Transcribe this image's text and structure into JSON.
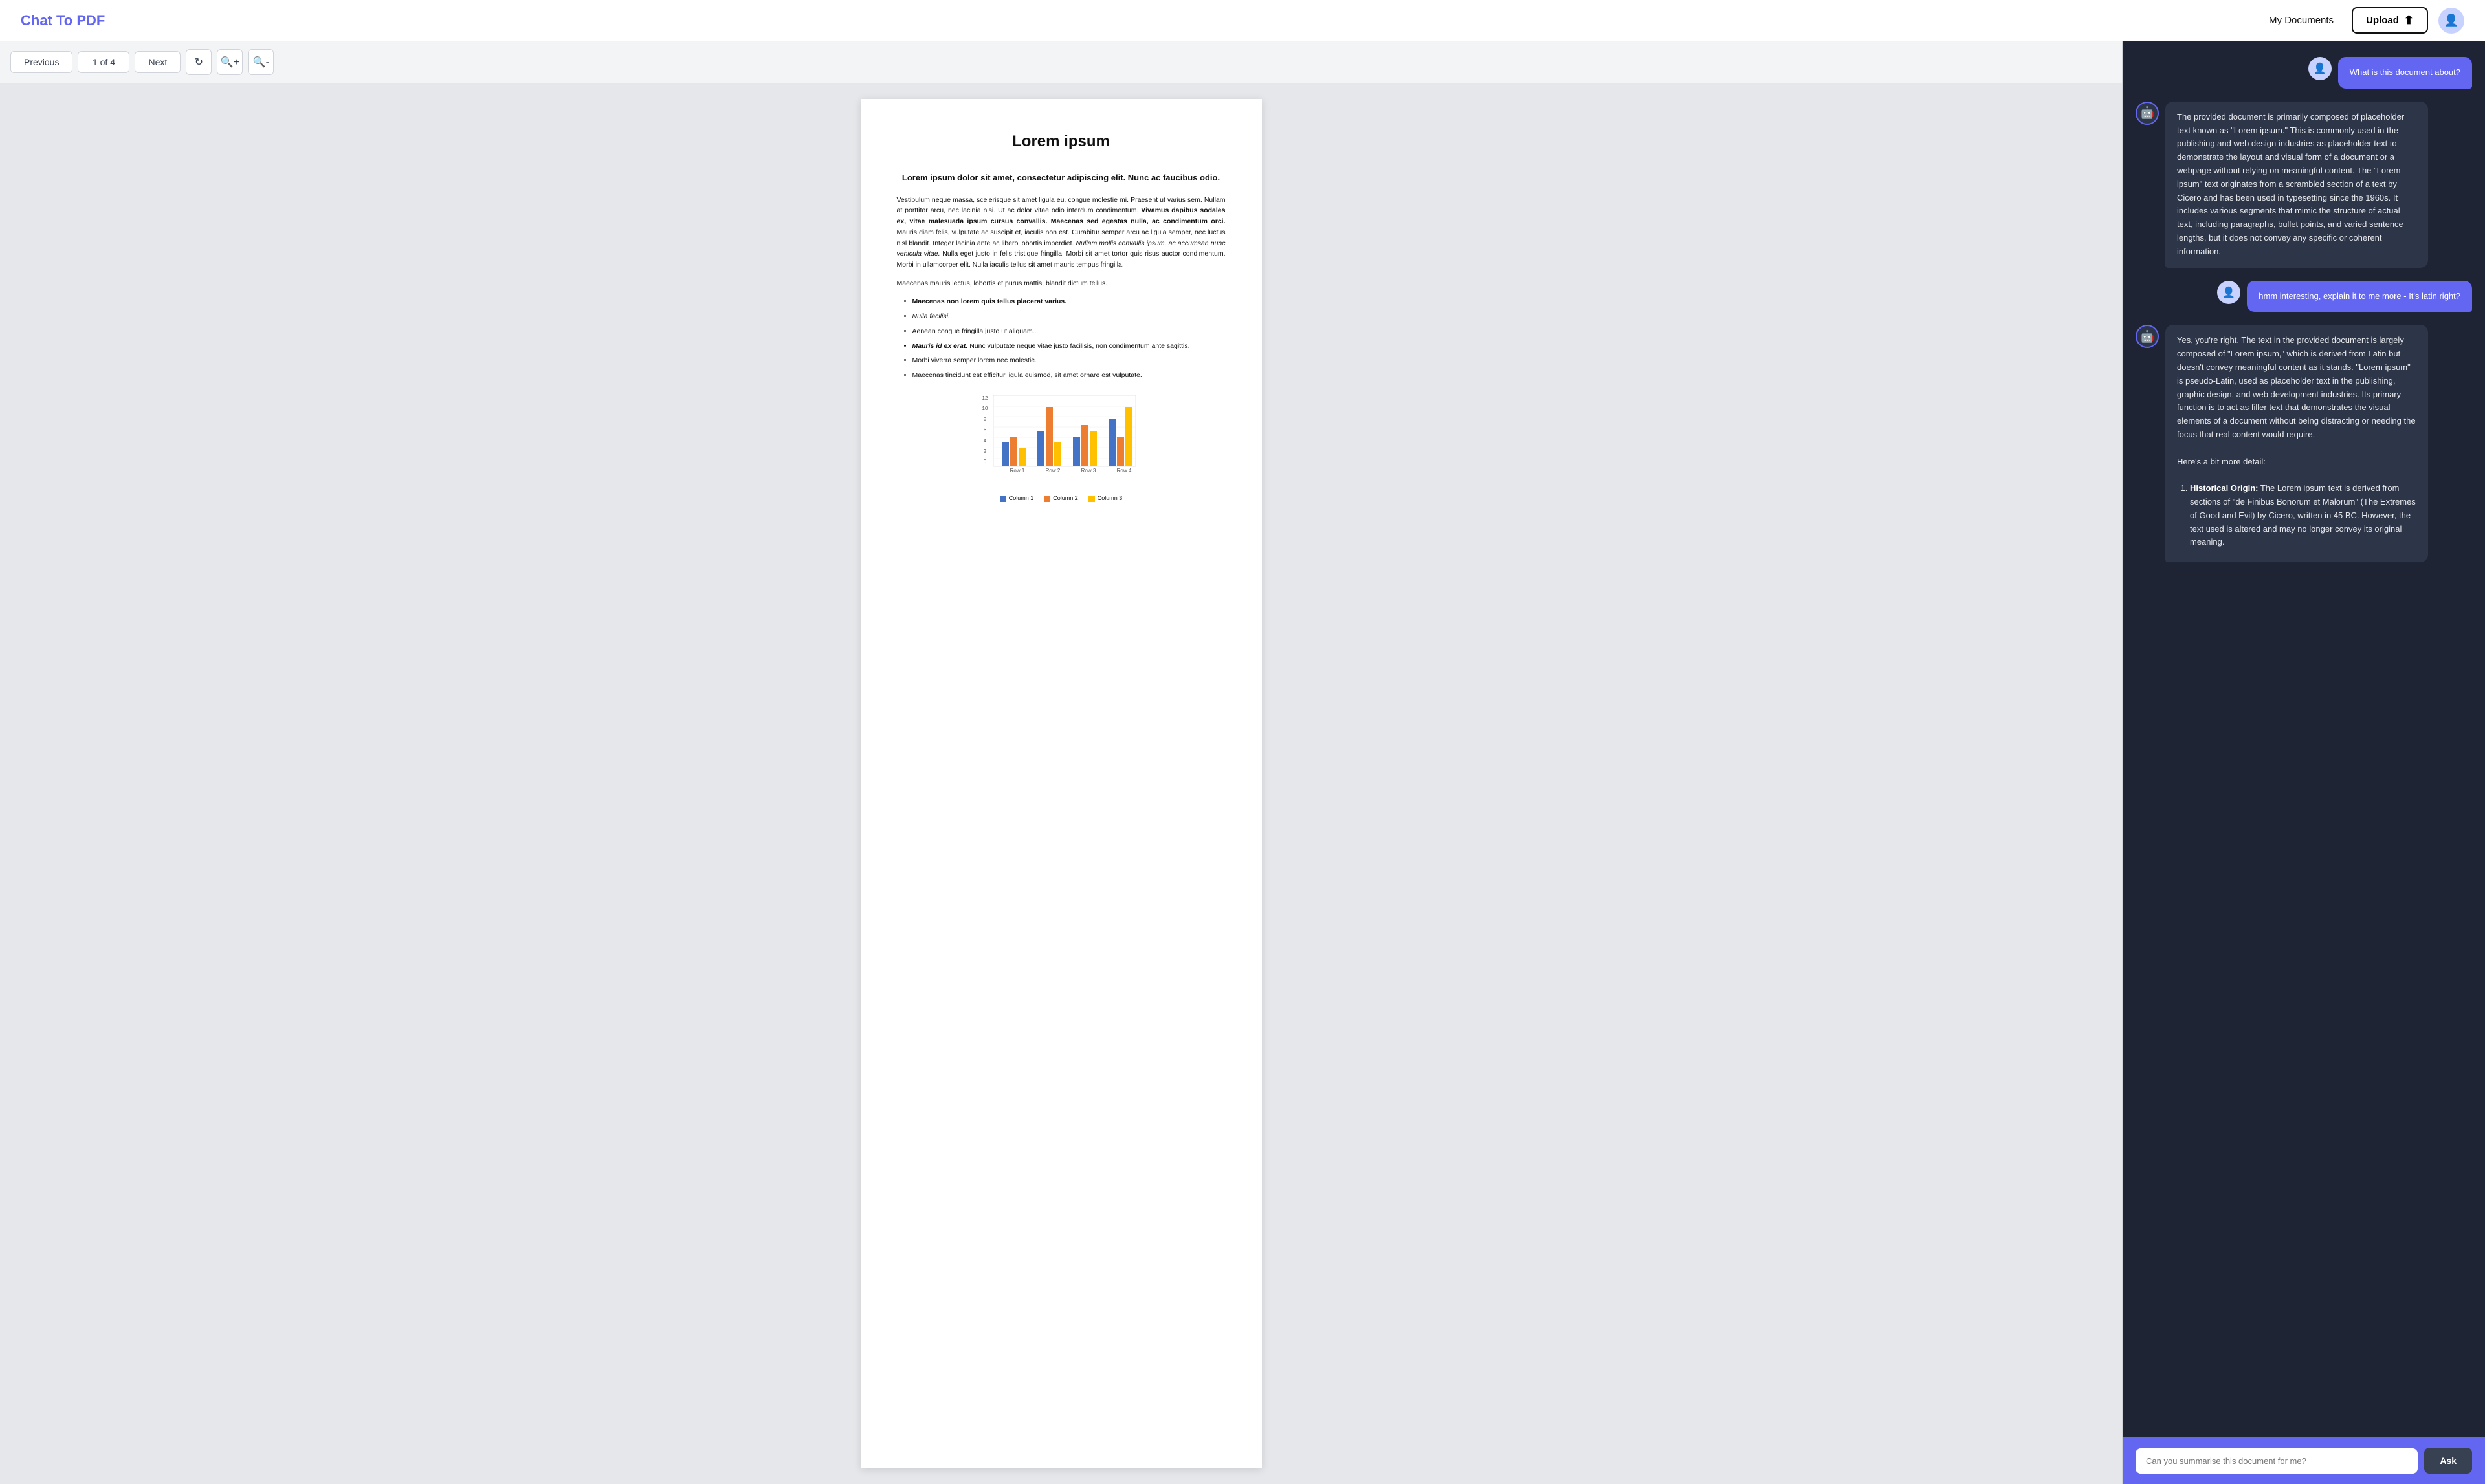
{
  "header": {
    "logo_text": "Chat To",
    "logo_highlight": "PDF",
    "my_docs_label": "My Documents",
    "upload_label": "Upload"
  },
  "toolbar": {
    "prev_label": "Previous",
    "page_indicator": "1 of 4",
    "next_label": "Next"
  },
  "pdf": {
    "title": "Lorem ipsum",
    "subtitle": "Lorem ipsum dolor sit amet, consectetur adipiscing elit. Nunc ac faucibus odio.",
    "body1": "Vestibulum neque massa, scelerisque sit amet ligula eu, congue molestie mi. Praesent ut varius sem. Nullam at porttitor arcu, nec lacinia nisi. Ut ac dolor vitae odio interdum condimentum.",
    "body1_bold": "Vivamus dapibus sodales ex, vitae malesuada ipsum cursus convallis. Maecenas sed egestas nulla, ac condimentum orci.",
    "body1_cont": "Mauris diam felis, vulputate ac suscipit et, iaculis non est. Curabitur semper arcu ac ligula semper, nec luctus nisl blandit. Integer lacinia ante ac libero lobortis imperdiet.",
    "body1_italic": "Nullam mollis convallis ipsum, ac accumsan nunc vehicula vitae.",
    "body1_end": "Nulla eget justo in felis tristique fringilla. Morbi sit amet tortor quis risus auctor condimentum. Morbi in ullamcorper elit. Nulla iaculis tellus sit amet mauris tempus fringilla.",
    "section_text": "Maecenas mauris lectus, lobortis et purus mattis, blandit dictum tellus.",
    "list_items": [
      {
        "text": "Maecenas non lorem quis tellus placerat varius.",
        "bold": true
      },
      {
        "text": "Nulla facilisi.",
        "italic": false
      },
      {
        "text": "Aenean congue fringilla justo ut aliquam..",
        "link": true
      },
      {
        "text": "Mauris id ex erat.",
        "bold_part": "Mauris id ex erat.",
        "rest": " Nunc vulputate neque vitae justo facilisis, non condimentum ante sagittis."
      },
      {
        "text": "Morbi viverra semper lorem nec molestie."
      },
      {
        "text": "Maecenas tincidunt est efficitur ligula euismod, sit amet ornare est vulputate."
      }
    ],
    "chart": {
      "y_labels": [
        "12",
        "10",
        "8",
        "6",
        "4",
        "2",
        "0"
      ],
      "x_labels": [
        "Row 1",
        "Row 2",
        "Row 3",
        "Row 4"
      ],
      "legend": [
        "Column 1",
        "Column 2",
        "Column 3"
      ],
      "colors": [
        "#4472C4",
        "#ED7D31",
        "#FFC000"
      ],
      "data": [
        [
          4,
          5,
          3
        ],
        [
          6,
          10,
          4
        ],
        [
          5,
          7,
          6
        ],
        [
          8,
          5,
          9
        ]
      ]
    }
  },
  "chat": {
    "messages": [
      {
        "role": "user",
        "text": "What is this document about?"
      },
      {
        "role": "bot",
        "text": "The provided document is primarily composed of placeholder text known as \"Lorem ipsum.\" This is commonly used in the publishing and web design industries as placeholder text to demonstrate the layout and visual form of a document or a webpage without relying on meaningful content. The \"Lorem ipsum\" text originates from a scrambled section of a text by Cicero and has been used in typesetting since the 1960s. It includes various segments that mimic the structure of actual text, including paragraphs, bullet points, and varied sentence lengths, but it does not convey any specific or coherent information."
      },
      {
        "role": "user",
        "text": "hmm interesting, explain it to me more - It's latin right?"
      },
      {
        "role": "bot",
        "text": "Yes, you're right. The text in the provided document is largely composed of \"Lorem ipsum,\" which is derived from Latin but doesn't convey meaningful content as it stands. \"Lorem ipsum\" is pseudo-Latin, used as placeholder text in the publishing, graphic design, and web development industries. Its primary function is to act as filler text that demonstrates the visual elements of a document without being distracting or needing the focus that real content would require.\n\nHere's a bit more detail:\n\n1. Historical Origin: The Lorem ipsum text is derived from sections of \"de Finibus Bonorum et Malorum\" (The Extremes of Good and Evil) by Cicero, written in 45 BC. However, the text used is altered and may no longer convey its original meaning."
      }
    ],
    "input_placeholder": "Can you summarise this document for me?",
    "ask_label": "Ask"
  }
}
